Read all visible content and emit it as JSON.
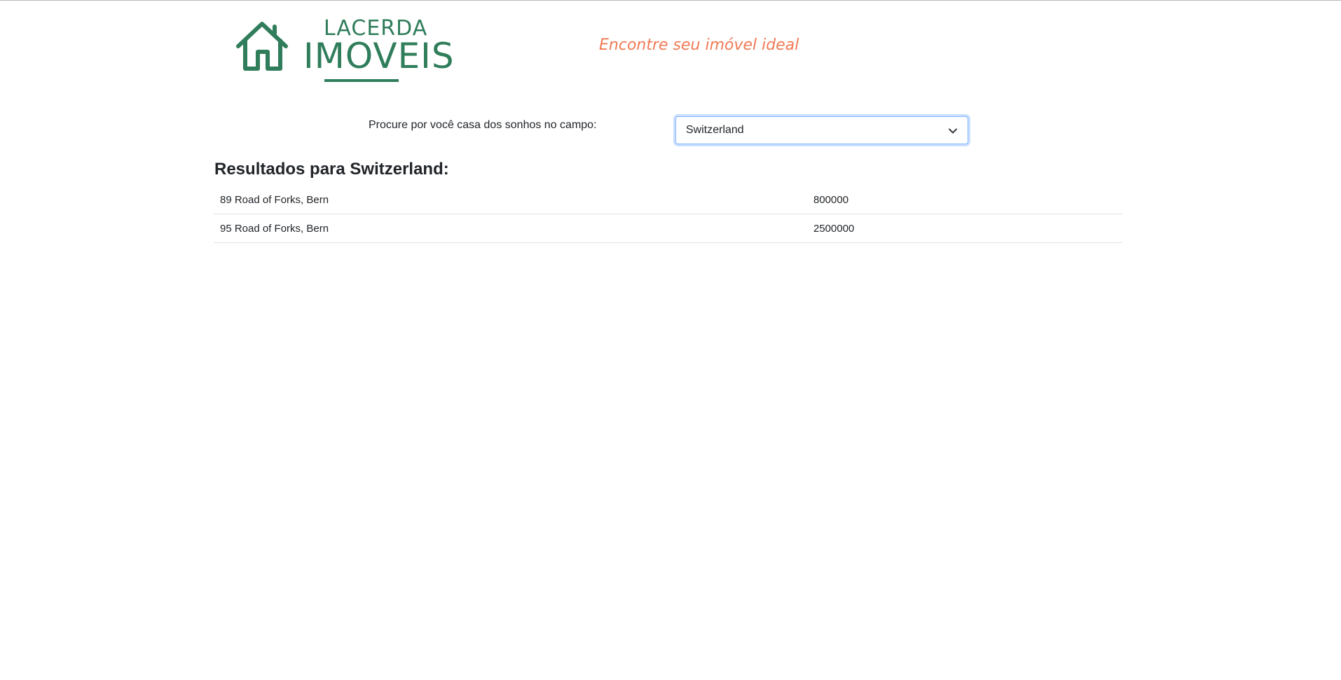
{
  "header": {
    "logo": {
      "top_text": "LACERDA",
      "main_text": "IMOVEIS",
      "brand_color": "#2f7d5a",
      "icon": "house-icon"
    },
    "tagline": "Encontre seu imóvel ideal",
    "tagline_color": "#f07a55"
  },
  "search": {
    "label": "Procure por você casa dos sonhos no campo:",
    "selected_value": "Switzerland",
    "dropdown_icon": "chevron-down-icon"
  },
  "results": {
    "title": "Resultados para Switzerland:",
    "rows": [
      {
        "address": "89 Road of Forks, Bern",
        "price": "800000"
      },
      {
        "address": "95 Road of Forks, Bern",
        "price": "2500000"
      }
    ]
  }
}
